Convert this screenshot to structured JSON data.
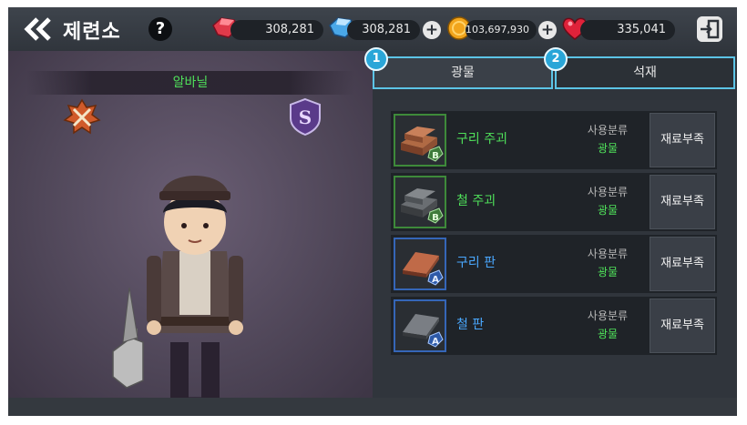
{
  "header": {
    "title": "제련소",
    "help_label": "?",
    "resources": [
      {
        "icon": "red-gem-icon",
        "value": "308,281"
      },
      {
        "icon": "blue-gem-icon",
        "value": "308,281"
      },
      {
        "icon": "gold-coin-icon",
        "value": "103,697,930"
      },
      {
        "icon": "heart-icon",
        "value": "335,041"
      }
    ],
    "plus_label": "+"
  },
  "character": {
    "name": "알바닐",
    "class_icon": "crossed-swords-icon",
    "grade_icon": "s-rank-shield-icon"
  },
  "tabs": [
    {
      "label": "광물",
      "badge": "1",
      "active": true
    },
    {
      "label": "석재",
      "badge": "2",
      "active": false
    }
  ],
  "items": [
    {
      "name": "구리 주괴",
      "grade": "B",
      "category_label": "사용분류",
      "category": "광물",
      "status": "재료부족",
      "color": "green"
    },
    {
      "name": "철 주괴",
      "grade": "B",
      "category_label": "사용분류",
      "category": "광물",
      "status": "재료부족",
      "color": "green"
    },
    {
      "name": "구리 판",
      "grade": "A",
      "category_label": "사용분류",
      "category": "광물",
      "status": "재료부족",
      "color": "blue"
    },
    {
      "name": "철 판",
      "grade": "A",
      "category_label": "사용분류",
      "category": "광물",
      "status": "재료부족",
      "color": "blue"
    }
  ],
  "colors": {
    "accent": "#5cc4e6",
    "green_text": "#4fe05a",
    "blue_text": "#4aa8ff"
  }
}
